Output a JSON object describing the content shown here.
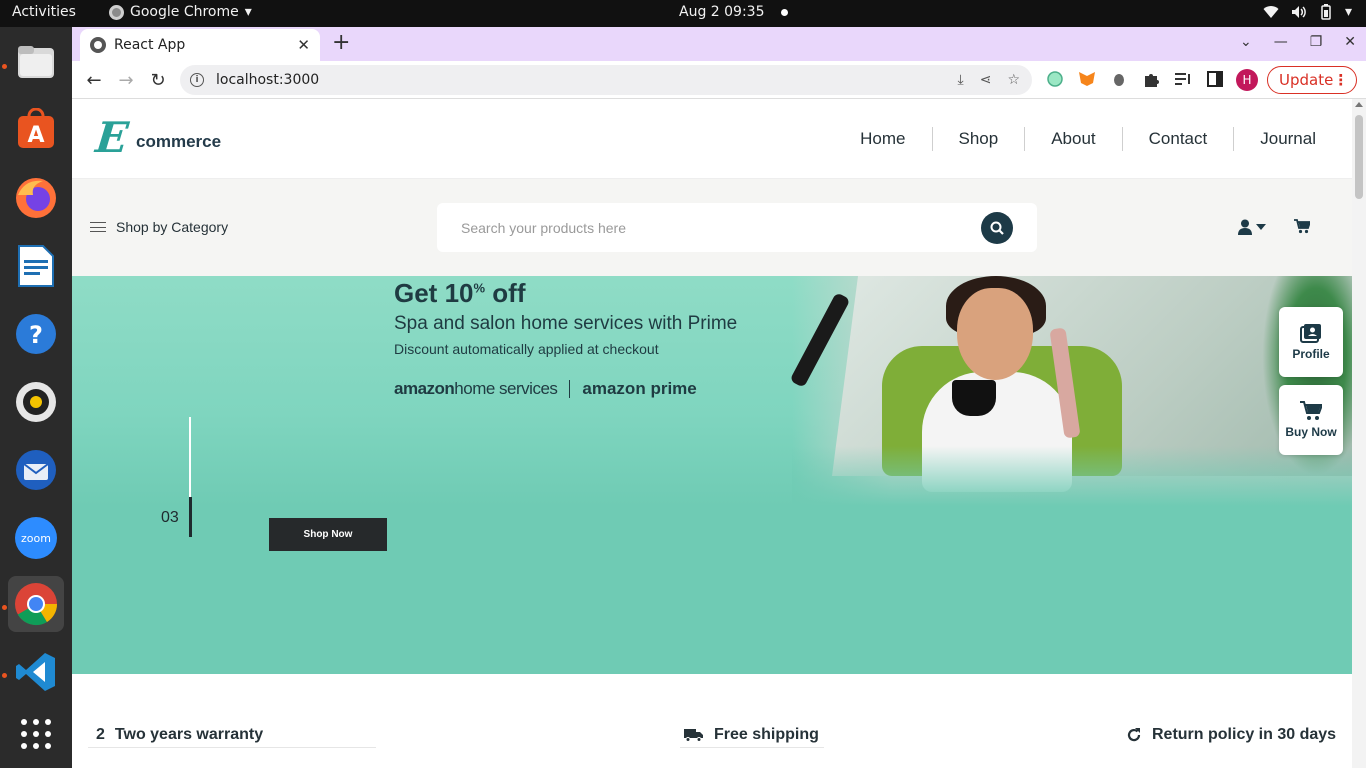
{
  "system": {
    "activities": "Activities",
    "app_name": "Google Chrome",
    "clock": "Aug 2  09:35"
  },
  "browser": {
    "tab_title": "React App",
    "url": "localhost:3000",
    "profile_initial": "H",
    "update_label": "Update"
  },
  "site": {
    "logo_letter": "E",
    "logo_word": "commerce",
    "nav": [
      "Home",
      "Shop",
      "About",
      "Contact",
      "Journal"
    ],
    "category_label": "Shop by Category",
    "search_placeholder": "Search your products here"
  },
  "hero": {
    "headline": "Get 10",
    "headline_sup": "%",
    "headline_tail": " off",
    "subheadline": "Spa and salon home services with Prime",
    "note": "Discount automatically applied at checkout",
    "brand1_bold": "amazon",
    "brand1_rest": "home services",
    "brand2_bold": "amazon",
    "brand2_rest": "prime",
    "slide_number": "03",
    "cta": "Shop Now"
  },
  "side_actions": {
    "profile": "Profile",
    "buy_now": "Buy Now"
  },
  "features": {
    "warranty_num": "2",
    "warranty": "Two years warranty",
    "shipping": "Free shipping",
    "returns": "Return policy in 30 days"
  },
  "colors": {
    "hero_bg": "#6fcbb4",
    "brand_dark": "#1d3a47",
    "logo_teal": "#2aa198",
    "update_red": "#d93025"
  }
}
